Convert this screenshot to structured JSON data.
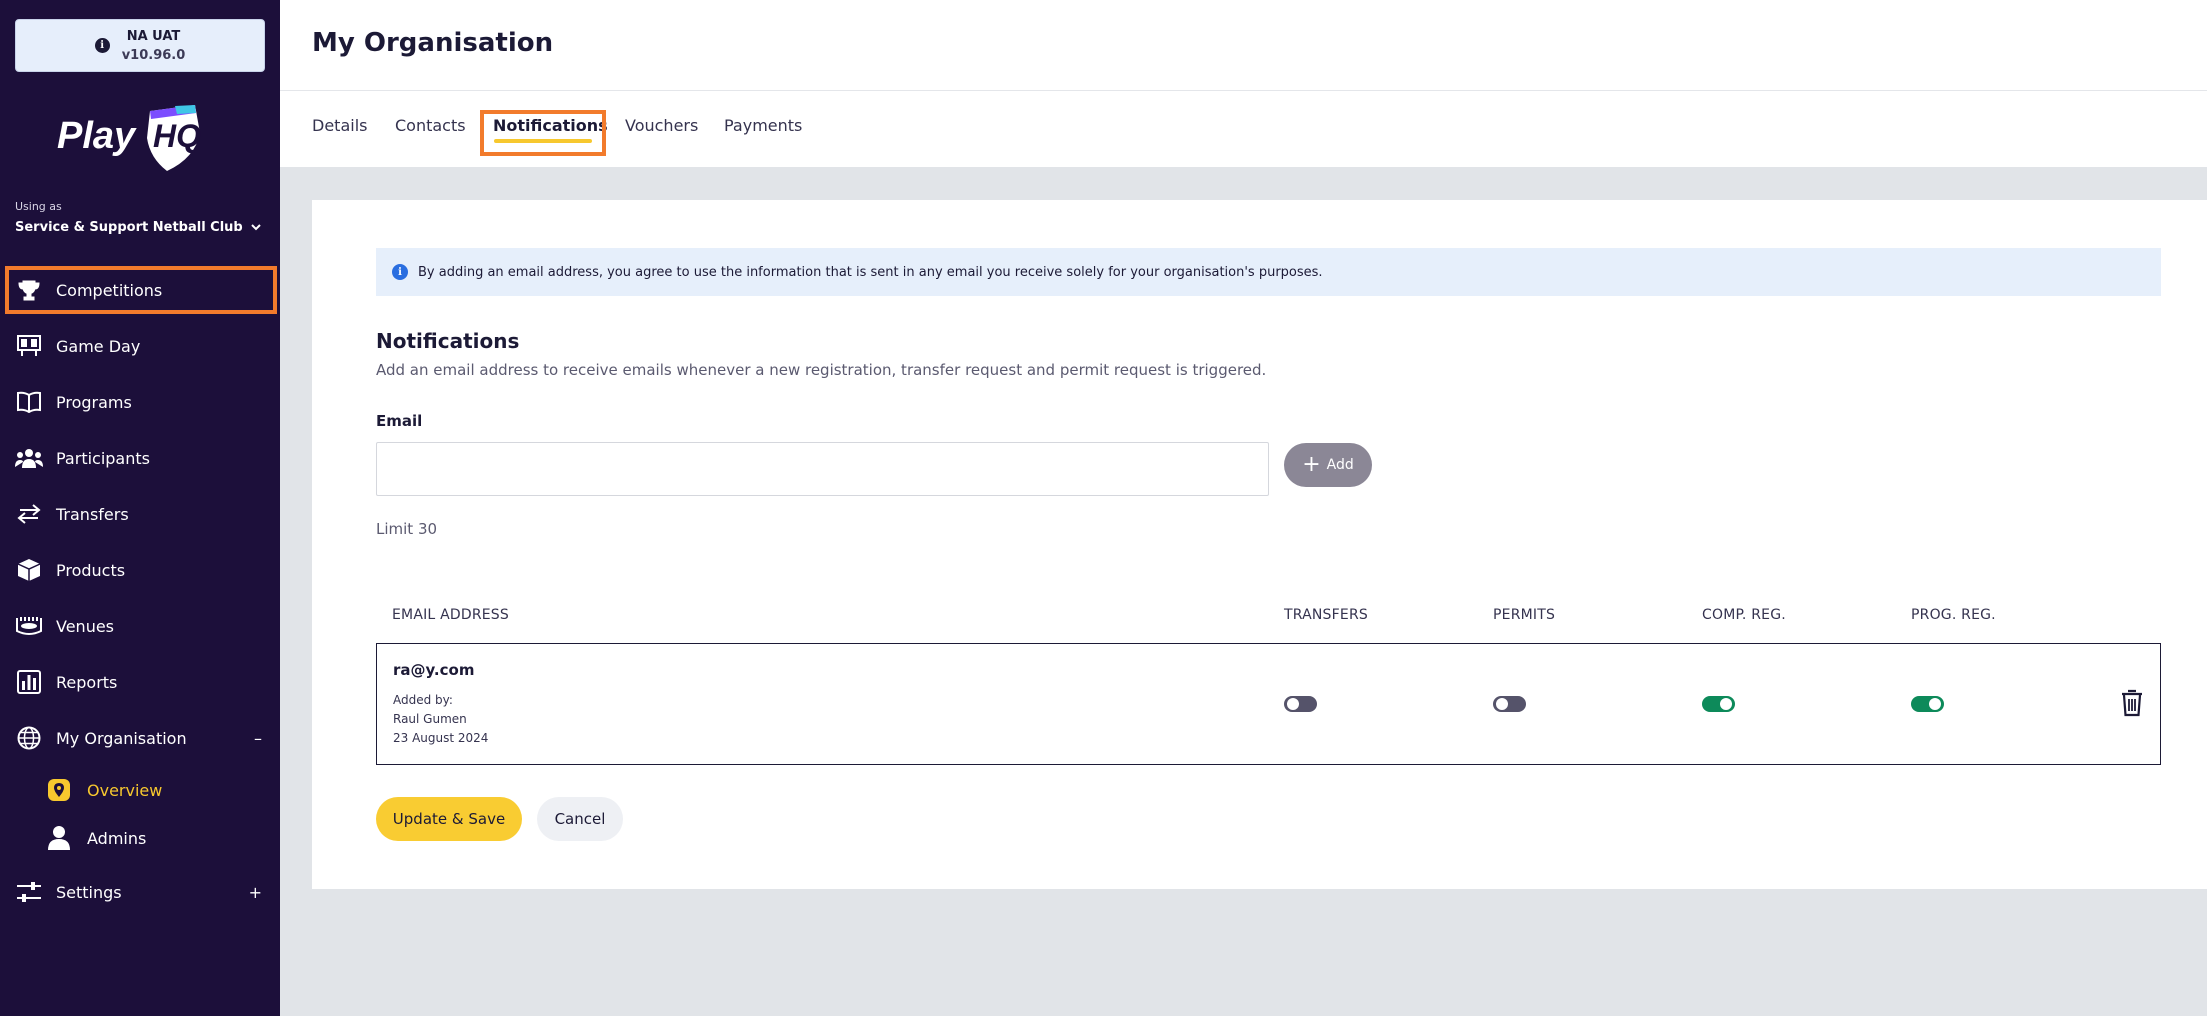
{
  "env": {
    "name": "NA UAT",
    "version": "v10.96.0",
    "icon": "info-icon"
  },
  "brand": {
    "logo_text": "PlayHQ"
  },
  "org_switcher": {
    "using_as": "Using as",
    "org_name": "Service & Support Netball Club"
  },
  "sidebar": {
    "items": [
      {
        "label": "Competitions",
        "icon": "trophy-icon"
      },
      {
        "label": "Game Day",
        "icon": "scoreboard-icon"
      },
      {
        "label": "Programs",
        "icon": "book-icon"
      },
      {
        "label": "Participants",
        "icon": "people-icon"
      },
      {
        "label": "Transfers",
        "icon": "transfer-arrows-icon"
      },
      {
        "label": "Products",
        "icon": "box-icon"
      },
      {
        "label": "Venues",
        "icon": "stadium-icon"
      },
      {
        "label": "Reports",
        "icon": "bar-chart-icon"
      },
      {
        "label": "My Organisation",
        "icon": "globe-icon",
        "toggle": "–"
      },
      {
        "label": "Settings",
        "icon": "sliders-icon",
        "toggle": "+"
      }
    ],
    "subitems": [
      {
        "label": "Overview",
        "icon": "location-pin-icon",
        "active": true
      },
      {
        "label": "Admins",
        "icon": "user-icon",
        "active": false
      }
    ]
  },
  "header": {
    "title": "My Organisation"
  },
  "tabs": [
    "Details",
    "Contacts",
    "Notifications",
    "Vouchers",
    "Payments"
  ],
  "active_tab": "Notifications",
  "banner": {
    "text": "By adding an email address, you agree to use the information that is sent in any email you receive solely for your organisation's purposes."
  },
  "notifications": {
    "title": "Notifications",
    "description": "Add an email address to receive emails whenever a new registration, transfer request and permit request is triggered.",
    "email_label": "Email",
    "email_value": "",
    "add_label": "Add",
    "limit": "Limit 30"
  },
  "table": {
    "headers": [
      "EMAIL ADDRESS",
      "TRANSFERS",
      "PERMITS",
      "COMP. REG.",
      "PROG. REG."
    ],
    "rows": [
      {
        "email": "ra@y.com",
        "added_by_label": "Added by:",
        "added_by": "Raul Gumen",
        "date": "23 August 2024",
        "transfers": false,
        "permits": false,
        "comp_reg": true,
        "prog_reg": true
      }
    ]
  },
  "actions": {
    "save": "Update & Save",
    "cancel": "Cancel"
  },
  "colors": {
    "sidebar_bg": "#1c0f3a",
    "accent_yellow": "#f7c82e",
    "highlight_orange": "#f27b2c",
    "toggle_on": "#0d8a5a"
  }
}
